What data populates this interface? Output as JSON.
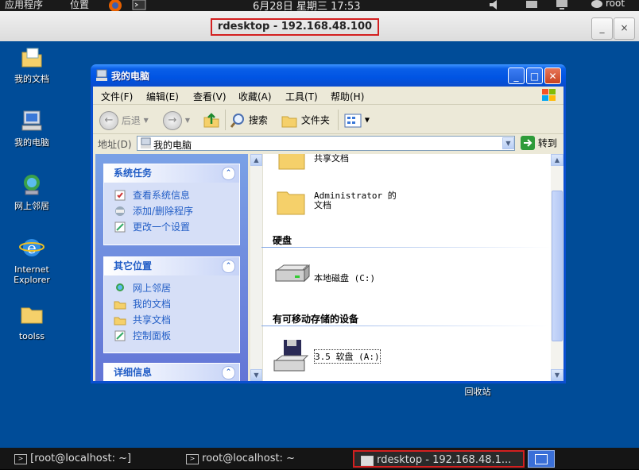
{
  "top_panel": {
    "applications": "应用程序",
    "places": "位置",
    "clock": "6月28日 星期三 17:53",
    "user": "root"
  },
  "rdesktop": {
    "title": "rdesktop - 192.168.48.100",
    "minimize": "_",
    "close": "×"
  },
  "desktop_icons": [
    {
      "label": "我的文档"
    },
    {
      "label": "我的电脑"
    },
    {
      "label": "网上邻居"
    },
    {
      "label": "Internet Explorer"
    },
    {
      "label": "toolss"
    },
    {
      "label": "回收站"
    }
  ],
  "window": {
    "title": "我的电脑",
    "menu": [
      "文件(F)",
      "编辑(E)",
      "查看(V)",
      "收藏(A)",
      "工具(T)",
      "帮助(H)"
    ],
    "toolbar": {
      "back": "后退",
      "search": "搜索",
      "folders": "文件夹"
    },
    "address_label": "地址(D)",
    "address_value": "我的电脑",
    "go": "转到"
  },
  "task_pane": {
    "system_tasks": {
      "title": "系统任务",
      "items": [
        "查看系统信息",
        "添加/删除程序",
        "更改一个设置"
      ]
    },
    "other_places": {
      "title": "其它位置",
      "items": [
        "网上邻居",
        "我的文档",
        "共享文档",
        "控制面板"
      ]
    },
    "details": {
      "title": "详细信息"
    }
  },
  "content": {
    "items_top": [
      "共享文档",
      "Administrator 的文档"
    ],
    "hard_disks_header": "硬盘",
    "local_disk": "本地磁盘 (C:)",
    "removable_header": "有可移动存储的设备",
    "floppy": "3.5 软盘 (A:)"
  },
  "taskbar": {
    "tasks": [
      "[root@localhost: ~]",
      "root@localhost: ~",
      "rdesktop - 192.168.48.1..."
    ]
  }
}
